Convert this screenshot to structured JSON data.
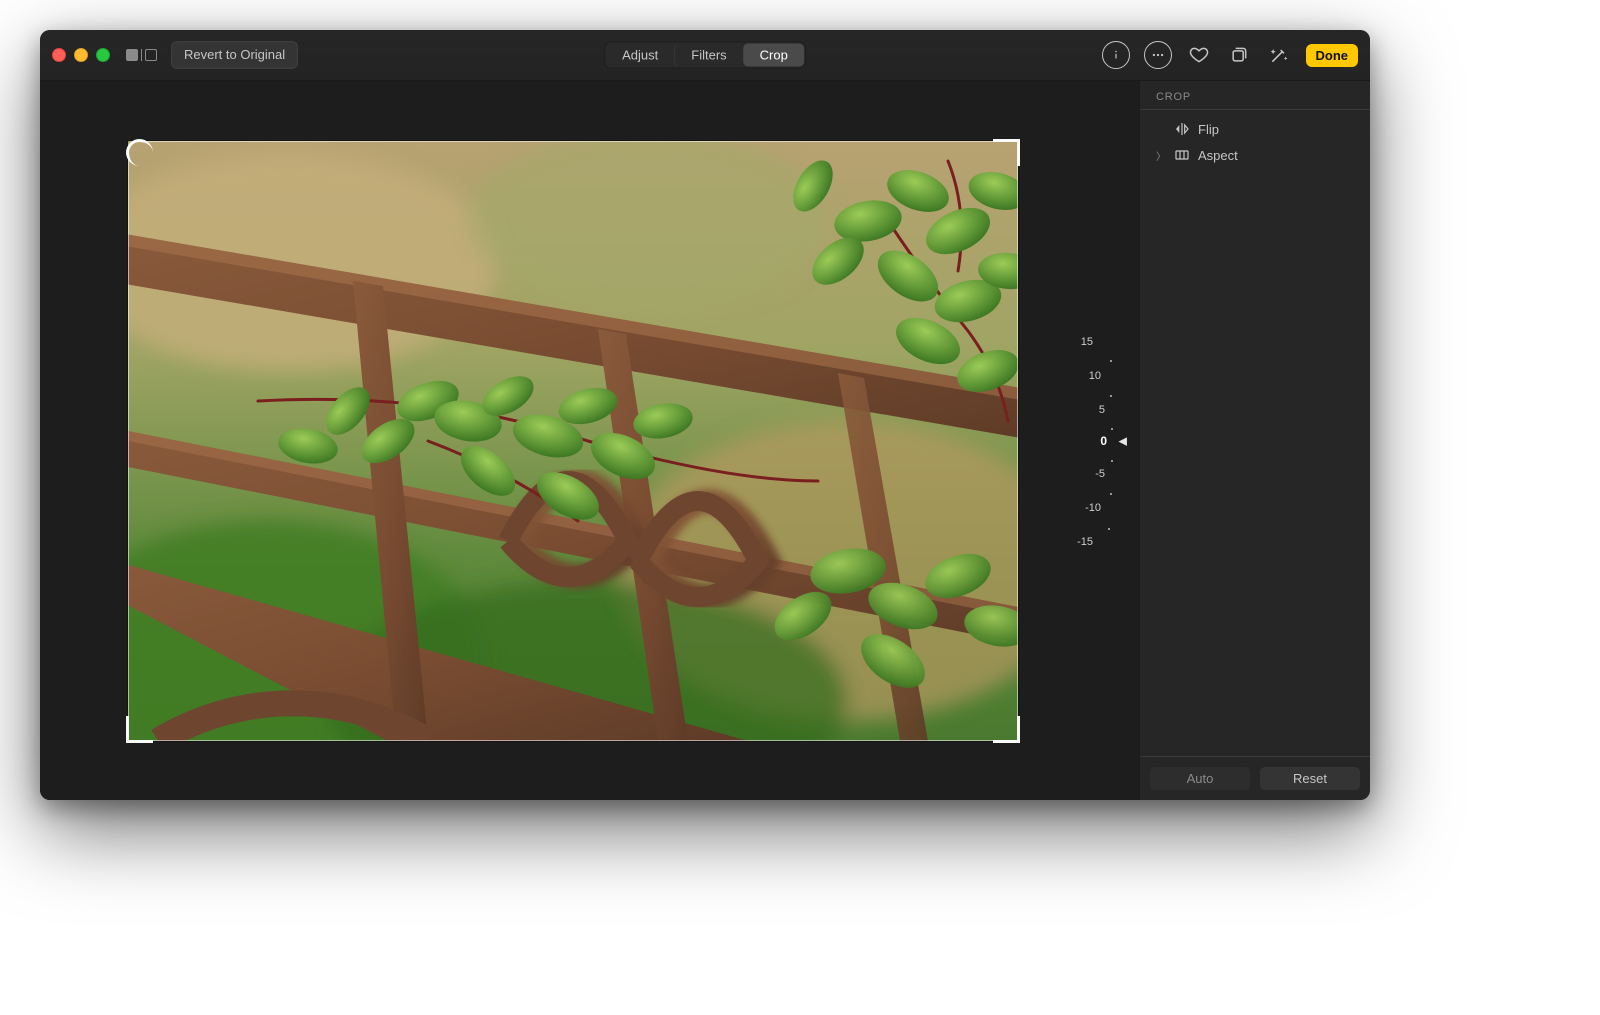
{
  "toolbar": {
    "revert_label": "Revert to Original",
    "tabs": {
      "adjust": "Adjust",
      "filters": "Filters",
      "crop": "Crop",
      "active": "crop"
    },
    "done_label": "Done",
    "icons": {
      "info": "info-icon",
      "more": "more-icon",
      "favorite": "heart-icon",
      "rotate": "rotate-icon",
      "enhance": "wand-icon"
    }
  },
  "panel": {
    "title": "CROP",
    "rows": {
      "flip": "Flip",
      "aspect": "Aspect"
    },
    "footer": {
      "auto": "Auto",
      "reset": "Reset"
    }
  },
  "dial": {
    "labels": [
      "15",
      "10",
      "5",
      "0",
      "-5",
      "-10",
      "-15"
    ],
    "value": 0
  }
}
